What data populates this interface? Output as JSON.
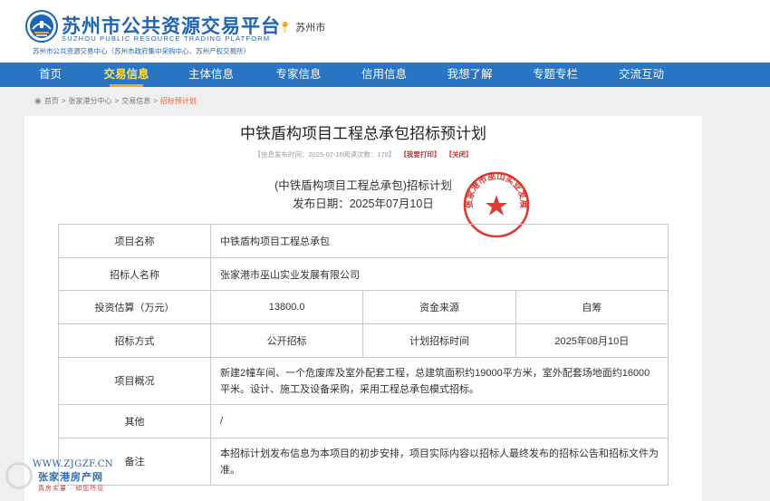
{
  "header": {
    "brand_title": "苏州市公共资源交易平台",
    "brand_subtitle_en": "SUZHOU PUBLIC RESOURCE TRADING PLATFORM",
    "brand_subtitle_cn": "苏州市公共资源交易中心（苏州市政府集中采购中心、苏州产权交易所）",
    "location": "苏州市",
    "pin_icon": "location-pin-icon"
  },
  "nav": {
    "items": [
      {
        "label": "首页",
        "active": false
      },
      {
        "label": "交易信息",
        "active": true
      },
      {
        "label": "主体信息",
        "active": false
      },
      {
        "label": "专家信息",
        "active": false
      },
      {
        "label": "信用信息",
        "active": false
      },
      {
        "label": "我想了解",
        "active": false
      },
      {
        "label": "专题专栏",
        "active": false
      },
      {
        "label": "交流互动",
        "active": false
      }
    ]
  },
  "breadcrumb": {
    "items": [
      "首页",
      "张家港分中心",
      "交易信息"
    ],
    "separator": ">",
    "current": "招标预计划"
  },
  "document": {
    "title": "中铁盾构项目工程总承包招标预计划",
    "meta_prefix": "【信息发布时间：2025-07-10阅读次数：178】",
    "print_label": "【我要打印】",
    "close_label": "【关闭】",
    "plan_title": "(中铁盾构项目工程总承包)招标计划",
    "plan_date": "发布日期：2025年07月10日",
    "seal_text": "张家港市巫山实业发展有限公司"
  },
  "table": {
    "project_name_label": "项目名称",
    "project_name_value": "中铁盾构项目工程总承包",
    "tenderer_label": "招标人名称",
    "tenderer_value": "张家港市巫山实业发展有限公司",
    "investment_label": "投资估算（万元）",
    "investment_value": "13800.0",
    "fund_source_label": "资金来源",
    "fund_source_value": "自筹",
    "tender_method_label": "招标方式",
    "tender_method_value": "公开招标",
    "plan_time_label": "计划招标时间",
    "plan_time_value": "2025年08月10日",
    "overview_label": "项目概况",
    "overview_value": "新建2幢车间、一个危废库及室外配套工程，总建筑面积约19000平方米，室外配套场地面约16000平米。设计、施工及设备采购，采用工程总承包模式招标。",
    "other_label": "其他",
    "other_value": "/",
    "remarks_label": "备注",
    "remarks_value": "本招标计划发布信息为本项目的初步安排，项目实际内容以招标人最终发布的招标公告和招标文件为准。"
  },
  "watermark": {
    "url": "WWW.ZJGZF.CN",
    "name": "张家港房产网",
    "slogan": "真房实量 · 如您所见"
  },
  "colors": {
    "nav_bg": "#2a74c4",
    "nav_active_text": "#ffe14d",
    "nav_active_underline": "#f5a623",
    "brand_blue": "#1e64b4",
    "seal_red": "#d8261c",
    "breadcrumb_current": "#e4633c"
  }
}
